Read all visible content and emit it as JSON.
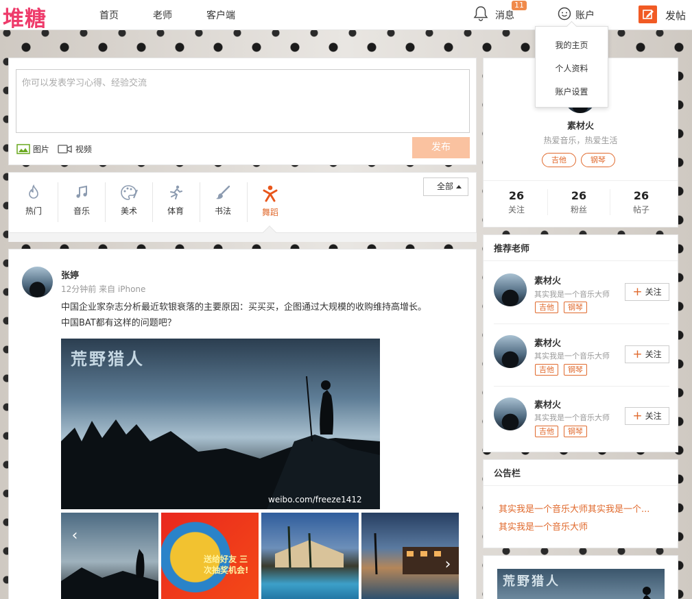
{
  "header": {
    "logo": "堆糖",
    "nav": [
      "首页",
      "老师",
      "客户端"
    ],
    "messages_label": "消息",
    "messages_badge": "11",
    "account_label": "账户",
    "post_label": "发帖"
  },
  "account_menu": [
    "我的主页",
    "个人资料",
    "账户设置"
  ],
  "composer": {
    "placeholder": "你可以发表学习心得、经验交流",
    "image_label": "图片",
    "video_label": "视频",
    "publish_label": "发布"
  },
  "categories": [
    {
      "label": "热门",
      "icon": "flame-icon"
    },
    {
      "label": "音乐",
      "icon": "music-note-icon"
    },
    {
      "label": "美术",
      "icon": "palette-icon"
    },
    {
      "label": "体育",
      "icon": "sport-icon"
    },
    {
      "label": "书法",
      "icon": "brush-icon"
    },
    {
      "label": "舞蹈",
      "icon": "dance-icon",
      "active": true
    }
  ],
  "filter": {
    "selected": "全部"
  },
  "post": {
    "author": "张婷",
    "meta": "12分钟前 来自 iPhone",
    "text_line1": "中国企业家杂志分析最近软银衰落的主要原因：买买买，企图通过大规模的收购维持高增长。",
    "text_line2": "中国BAT都有这样的问题吧？",
    "main_image_title": "荒野猎人",
    "main_image_watermark": "weibo.com/freeze1412",
    "poster_text": "送给好友 三次抽奖机会!"
  },
  "profile": {
    "name": "素材火",
    "bio": "热爱音乐，热爱生活",
    "tags": [
      "吉他",
      "钢琴"
    ],
    "stats": [
      {
        "num": "26",
        "label": "关注"
      },
      {
        "num": "26",
        "label": "粉丝"
      },
      {
        "num": "26",
        "label": "帖子"
      }
    ]
  },
  "teachers": {
    "title": "推荐老师",
    "follow_label": "关注",
    "items": [
      {
        "name": "素材火",
        "desc": "其实我是一个音乐大师",
        "tags": [
          "吉他",
          "钢琴"
        ]
      },
      {
        "name": "素材火",
        "desc": "其实我是一个音乐大师",
        "tags": [
          "吉他",
          "钢琴"
        ]
      },
      {
        "name": "素材火",
        "desc": "其实我是一个音乐大师",
        "tags": [
          "吉他",
          "钢琴"
        ]
      }
    ]
  },
  "notice": {
    "title": "公告栏",
    "items": [
      "其实我是一个音乐大师其实我是一个...",
      "其实我是一个音乐大师"
    ]
  },
  "colors": {
    "accent": "#e0692c",
    "logo": "#ee3b6b",
    "publish_disabled": "#fac2a0"
  }
}
